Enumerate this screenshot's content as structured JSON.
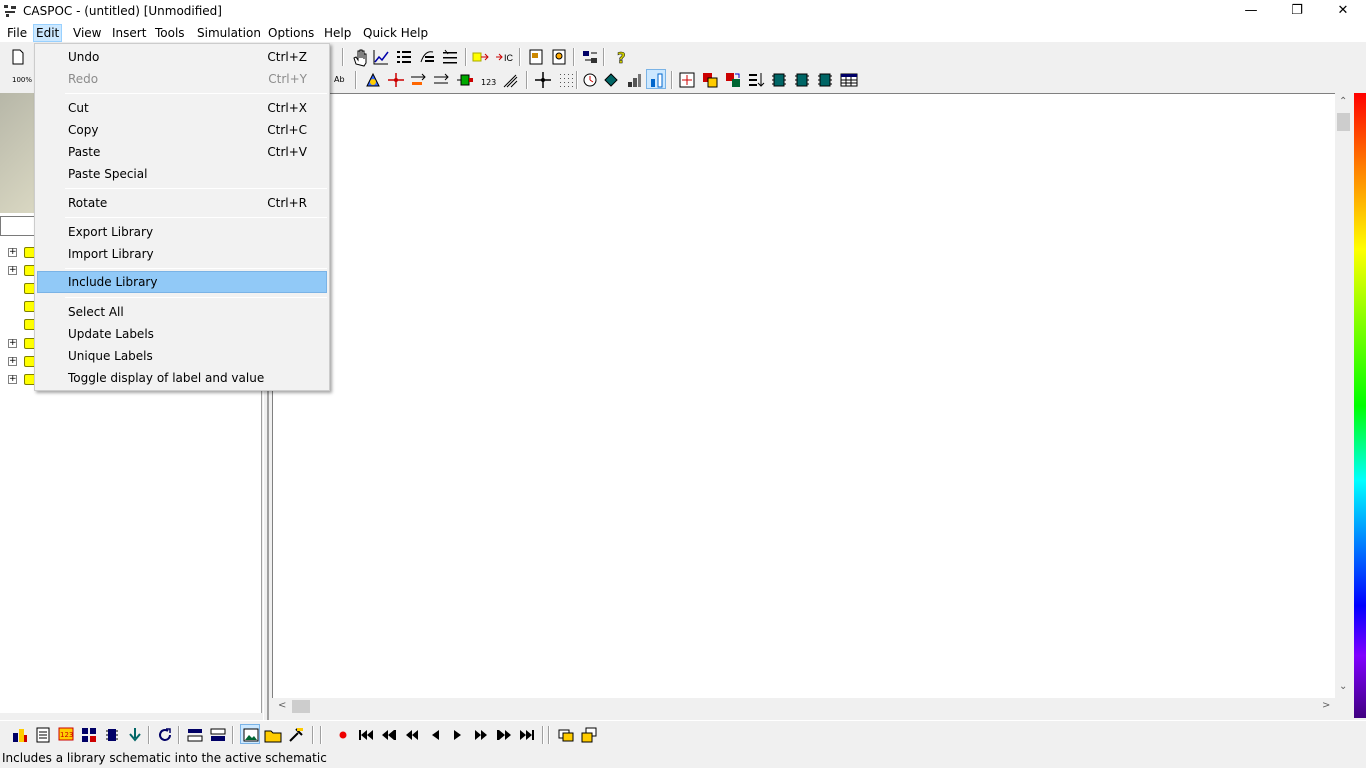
{
  "window": {
    "title": "CASPOC - (untitled) [Unmodified]"
  },
  "menubar": {
    "items": [
      "File",
      "Edit",
      "View",
      "Insert",
      "Tools",
      "Simulation",
      "Options",
      "Help",
      "Quick Help"
    ]
  },
  "edit_menu": {
    "items": [
      {
        "label": "Undo",
        "shortcut": "Ctrl+Z"
      },
      {
        "label": "Redo",
        "shortcut": "Ctrl+Y"
      },
      {
        "label": "Cut",
        "shortcut": "Ctrl+X"
      },
      {
        "label": "Copy",
        "shortcut": "Ctrl+C"
      },
      {
        "label": "Paste",
        "shortcut": "Ctrl+V"
      },
      {
        "label": "Paste Special",
        "shortcut": ""
      },
      {
        "label": "Rotate",
        "shortcut": "Ctrl+R"
      },
      {
        "label": "Export Library",
        "shortcut": ""
      },
      {
        "label": "Import Library",
        "shortcut": ""
      },
      {
        "label": "Include Library",
        "shortcut": ""
      },
      {
        "label": "Select All",
        "shortcut": ""
      },
      {
        "label": "Update Labels",
        "shortcut": ""
      },
      {
        "label": "Unique Labels",
        "shortcut": ""
      },
      {
        "label": "Toggle display of label and value",
        "shortcut": ""
      }
    ]
  },
  "toolbar": {
    "zoom_label": "100%",
    "text_tool_label": "Ab",
    "counter_label": "123"
  },
  "status": {
    "text": "Includes a library schematic into the active schematic"
  },
  "colors": {
    "menu_highlight": "#91c9f7",
    "menubar_active": "#cce8ff",
    "folder": "#ffff00"
  }
}
